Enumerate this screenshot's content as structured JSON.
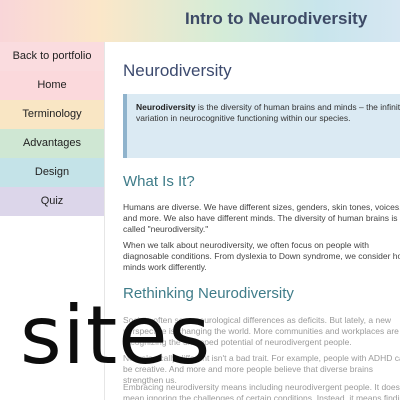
{
  "header": {
    "title": "Intro to Neurodiversity"
  },
  "sidebar": {
    "items": [
      {
        "label": "Back to portfolio"
      },
      {
        "label": "Home"
      },
      {
        "label": "Terminology"
      },
      {
        "label": "Advantages"
      },
      {
        "label": "Design"
      },
      {
        "label": "Quiz"
      }
    ]
  },
  "main": {
    "title": "Neurodiversity",
    "callout": {
      "term": "Neurodiversity",
      "text": " is the diversity of human brains and minds – the infinite variation in neurocognitive functioning within our species."
    },
    "section1": {
      "heading": "What Is It?",
      "p1": "Humans are diverse. We have different sizes, genders, skin tones, voices, and more. We also have different minds. The diversity of human brains is called \"neurodiversity.\"",
      "p2": "When we talk about neurodiversity, we often focus on people with diagnosable conditions. From dyslexia to Down syndrome, we consider how minds work differently."
    },
    "section2": {
      "heading": "Rethinking Neurodiversity",
      "p1": "Society often sees neurological differences as deficits. But lately, a new perspective is changing the world. More communities and workplaces are recognizing the untapped potential of neurodivergent people.",
      "p2": "Neurologically different isn't a bad trait. For example, people with ADHD can be creative. And more and more people believe that diverse brains strengthen us.",
      "p3": "Embracing neurodiversity means including neurodivergent people. It doesn't mean ignoring the challenges of certain conditions. Instead, it means finding work-arounds and recognizing"
    }
  },
  "overlay": {
    "text": "sites"
  }
}
